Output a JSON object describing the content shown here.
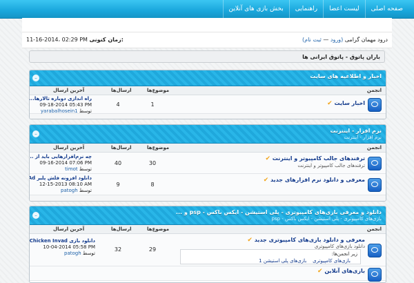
{
  "nav": {
    "items": [
      "صفحه اصلی",
      "لیست اعضا",
      "راهنمایی",
      "بخش بازی های آنلاین"
    ]
  },
  "infobar": {
    "welcome_prefix": "درود مهمان گرامی",
    "login": "(ورود",
    "sep": "—",
    "register": "ثبت نام)",
    "time_label": "زمان کنونی:",
    "time_value": "11-16-2014، 02:29 PM"
  },
  "breadcrumb": "باران پاتوق - پاتوق ایرانی ها",
  "sections": [
    {
      "title": "اخبار و اطلاعیه های سایت",
      "desc": "",
      "headers": {
        "forum": "انجمن",
        "topics": "موضوع‌ها",
        "posts": "ارسال‌ها",
        "last": "آخرین ارسال"
      },
      "rows": [
        {
          "name": "اخبار سایت",
          "desc": "",
          "topics": "1",
          "posts": "4",
          "last_title": "راه اندازی دوباره تالارها...",
          "last_date": "09-18-2014 05:43 PM",
          "last_by": "توسط",
          "last_user": "yarabalhosein1"
        }
      ]
    },
    {
      "title": "نرم افزار - اینترنت",
      "desc": "نرم افزار - اینترنت",
      "headers": {
        "forum": "انجمن",
        "topics": "موضوع‌ها",
        "posts": "ارسال‌ها",
        "last": "آخرین ارسال"
      },
      "rows": [
        {
          "name": "ترفندهای جالب کامپیوتر و اینترنت",
          "desc": "ترفندهای جالب کامپیوتر و اینترنت",
          "topics": "30",
          "posts": "40",
          "last_title": "چه نرم‌افزارهایی باید از ...",
          "last_date": "09-16-2014 07:06 PM",
          "last_by": "توسط",
          "last_user": "timot"
        },
        {
          "name": "معرفی و دانلود نرم افزارهای جدید",
          "desc": "",
          "topics": "8",
          "posts": "9",
          "last_title": "دانلود افزونه فلش پلیر Ad...",
          "last_date": "12-15-2013 08:10 AM",
          "last_by": "توسط",
          "last_user": "patogh"
        }
      ]
    },
    {
      "title": "دانلود و معرفی بازی‌های کامپیوتری - پلی استیشن - ایکس باکس - psp و ...",
      "desc": "بازی‌های کامپیوتری - پلی استیشن - ایکس باکس - psp",
      "headers": {
        "forum": "انجمن",
        "topics": "موضوع‌ها",
        "posts": "ارسال‌ها",
        "last": "آخرین ارسال"
      },
      "rows": [
        {
          "name": "معرفی و دانلود بازی‌های کامپیوتری جدید",
          "desc": "دانلود بازی‌های کامپیوتری",
          "topics": "29",
          "posts": "32",
          "last_title": "دانلود بازی Chicken Invad...",
          "last_date": "10-04-2014 05:58 PM",
          "last_by": "توسط",
          "last_user": "patogh",
          "sub_label": "زیر انجمن‌ها:",
          "subforums": [
            "بازی‌های کامپیوتری",
            "بازی‌های پلی استیشن 1"
          ]
        },
        {
          "name": "بازی‌های آنلاین",
          "desc": "",
          "topics": "",
          "posts": "",
          "last_title": "",
          "last_date": "",
          "last_by": "",
          "last_user": ""
        }
      ]
    }
  ],
  "colors": {
    "nav": "#1aa7dc",
    "accent": "#29b6e8",
    "link": "#123a8c",
    "tick": "#f2a51a"
  }
}
